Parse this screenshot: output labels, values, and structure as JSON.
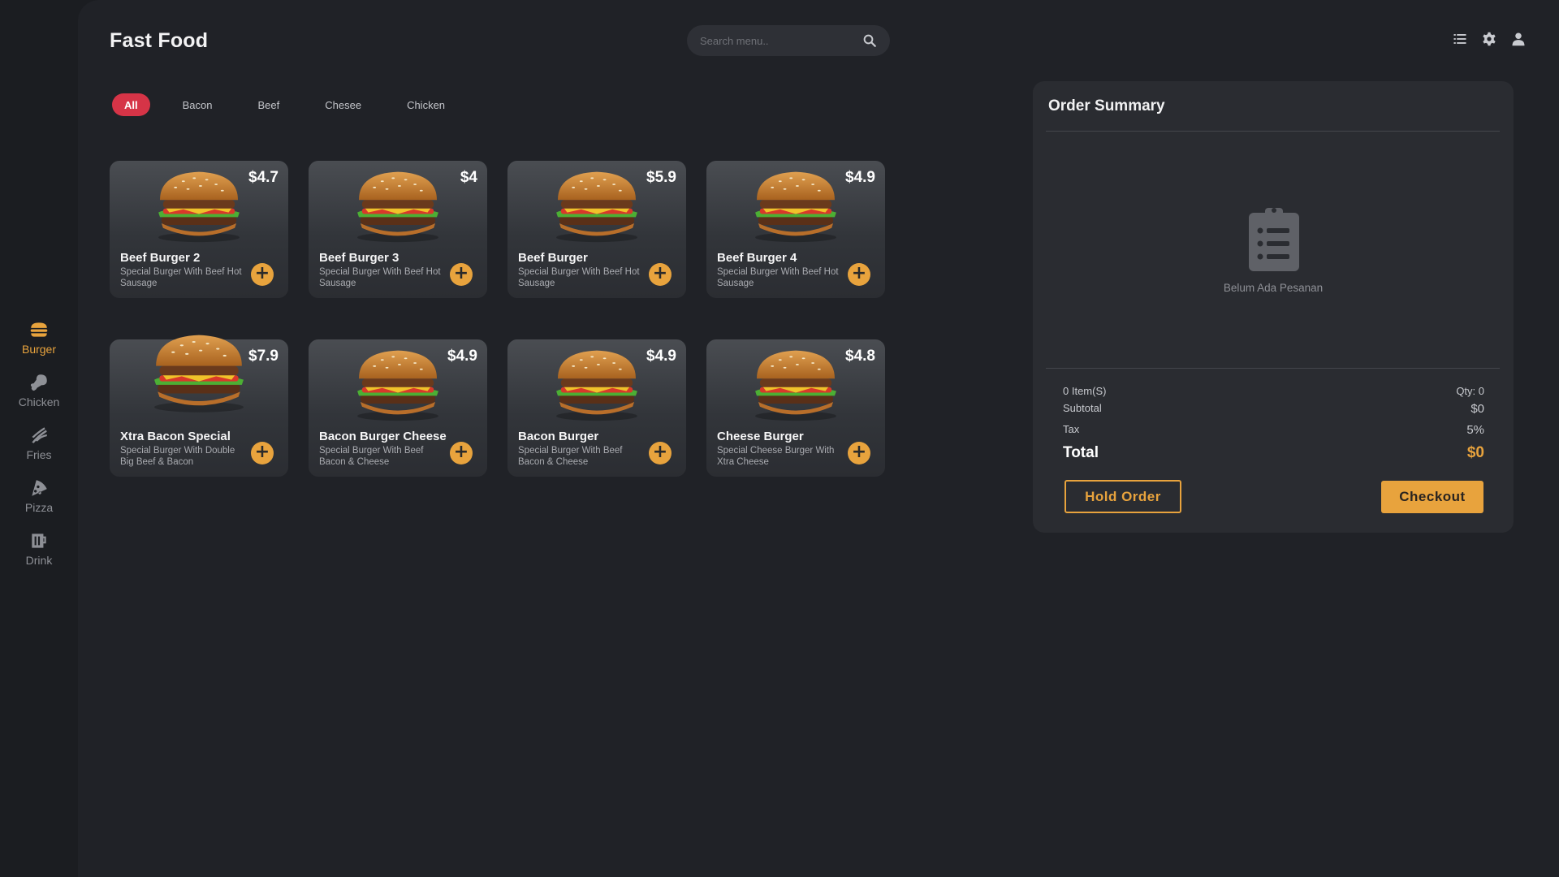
{
  "sidebar": {
    "items": [
      {
        "label": "Burger",
        "icon": "burger-icon",
        "active": true
      },
      {
        "label": "Chicken",
        "icon": "chicken-leg-icon"
      },
      {
        "label": "Fries",
        "icon": "fries-icon"
      },
      {
        "label": "Pizza",
        "icon": "pizza-icon"
      },
      {
        "label": "Drink",
        "icon": "drink-icon"
      }
    ]
  },
  "header": {
    "title": "Fast Food",
    "search_placeholder": "Search menu..",
    "icons": [
      "list-icon",
      "gear-icon",
      "user-icon"
    ]
  },
  "tabs": [
    {
      "label": "All",
      "active": true
    },
    {
      "label": "Bacon"
    },
    {
      "label": "Beef"
    },
    {
      "label": "Chesee"
    },
    {
      "label": "Chicken"
    }
  ],
  "products": [
    {
      "name": "Beef Burger 2",
      "price": "$4.7",
      "desc": "Special Burger With Beef Hot Sausage"
    },
    {
      "name": "Beef Burger 3",
      "price": "$4",
      "desc": "Special Burger With Beef Hot Sausage"
    },
    {
      "name": "Beef Burger",
      "price": "$5.9",
      "desc": "Special Burger With Beef Hot Sausage"
    },
    {
      "name": "Beef Burger 4",
      "price": "$4.9",
      "desc": "Special Burger With Beef Hot Sausage"
    },
    {
      "name": "Xtra Bacon Special",
      "price": "$7.9",
      "desc": "Special Burger With Double Big Beef & Bacon"
    },
    {
      "name": "Bacon Burger Cheese",
      "price": "$4.9",
      "desc": "Special Burger With Beef Bacon & Cheese"
    },
    {
      "name": "Bacon Burger",
      "price": "$4.9",
      "desc": "Special Burger With Beef Bacon & Cheese"
    },
    {
      "name": "Cheese Burger",
      "price": "$4.8",
      "desc": "Special Cheese Burger With Xtra Cheese"
    }
  ],
  "add_label": "+",
  "order": {
    "title": "Order Summary",
    "empty_text": "Belum Ada Pesanan",
    "items_label": "0 Item(S)",
    "qty_label": "Qty: 0",
    "subtotal_label": "Subtotal",
    "subtotal_value": "$0",
    "tax_label": "Tax",
    "tax_value": "5%",
    "total_label": "Total",
    "total_value": "$0",
    "hold_label": "Hold Order",
    "checkout_label": "Checkout"
  },
  "colors": {
    "accent": "#e8a33d",
    "active_tab": "#d63447",
    "background": "#1b1d21",
    "panel": "#2a2c31"
  }
}
